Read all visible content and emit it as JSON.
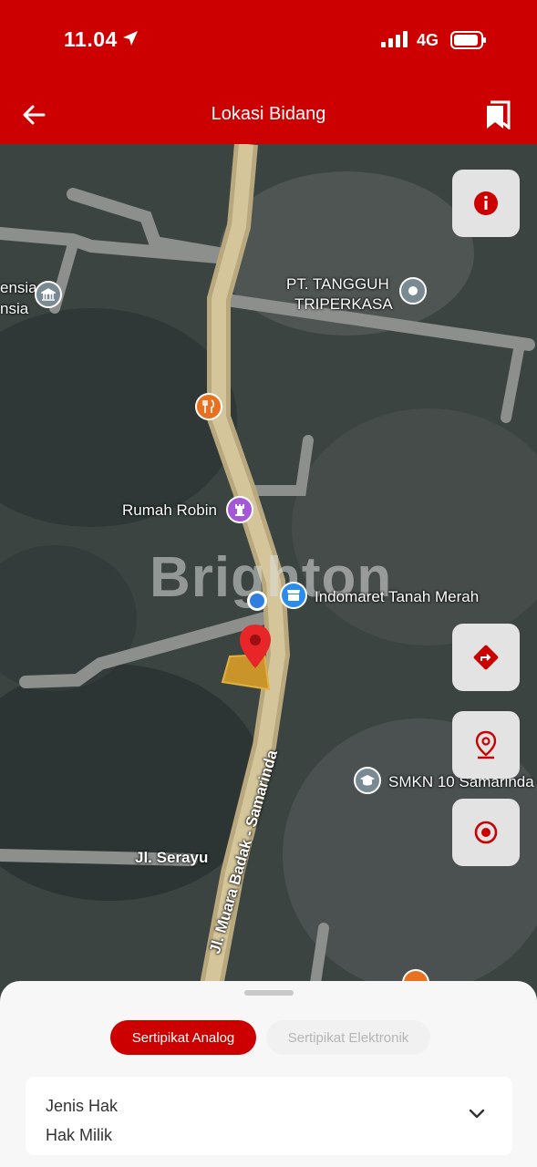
{
  "status_bar": {
    "time": "11.04",
    "network": "4G"
  },
  "header": {
    "title": "Lokasi Bidang"
  },
  "map": {
    "watermark": "Brighton",
    "labels": {
      "pt_name_line1": "PT. TANGGUH",
      "pt_name_line2": "TRIPERKASA",
      "rumah_robin": "Rumah Robin",
      "indomaret": "Indomaret Tanah Merah",
      "smkn": "SMKN 10 Samarinda",
      "jl_serayu": "Jl. Serayu",
      "jl_muara": "Jl. Muara Badak - Samarinda",
      "left_line1": "ensia",
      "left_line2": "nsia"
    }
  },
  "bottom_sheet": {
    "tabs": [
      "Sertipikat Analog",
      "Sertipikat Elektronik"
    ],
    "field_label": "Jenis Hak",
    "field_value": "Hak Milik"
  },
  "colors": {
    "brand": "#cc0000",
    "parcel": "#c9952a"
  }
}
